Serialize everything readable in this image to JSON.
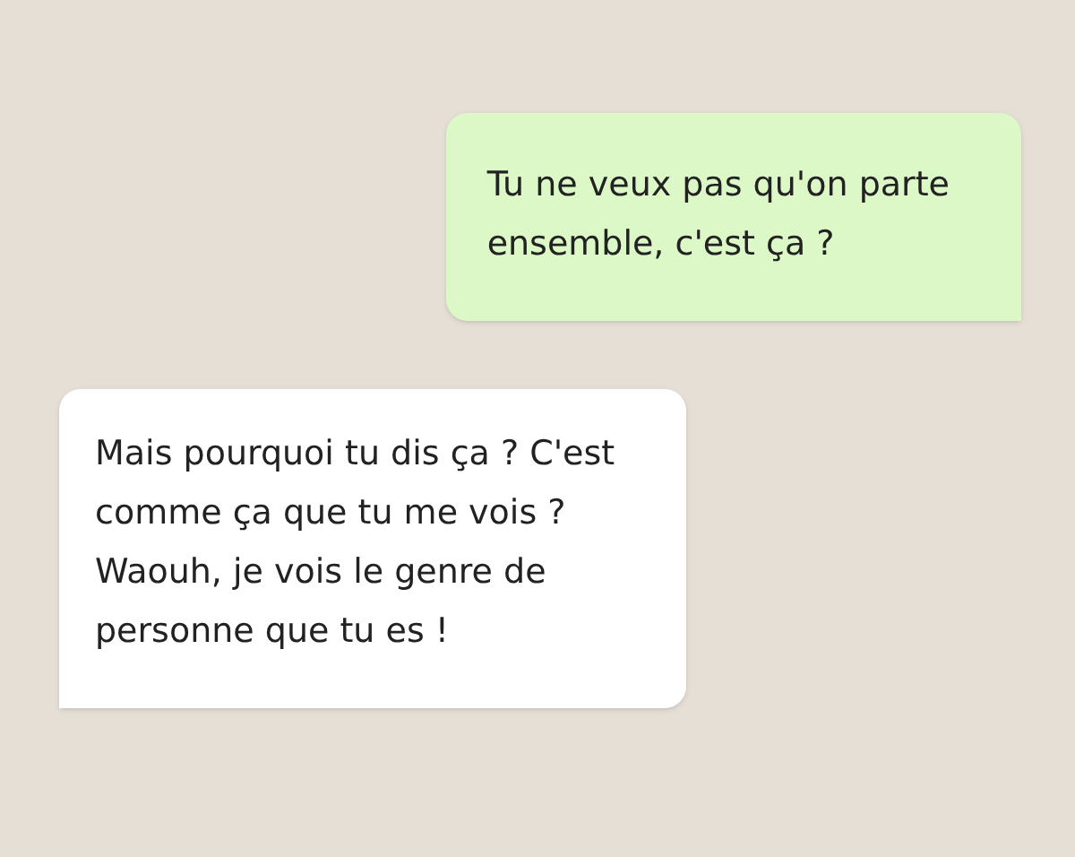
{
  "messages": [
    {
      "kind": "outgoing",
      "text": "Tu ne veux pas qu'on parte\nensemble, c'est ça ?"
    },
    {
      "kind": "incoming",
      "text": "Mais pourquoi tu dis ça ? C'est\ncomme ça que tu me vois ?\nWaouh, je vois le genre de\npersonne que tu es !"
    }
  ]
}
